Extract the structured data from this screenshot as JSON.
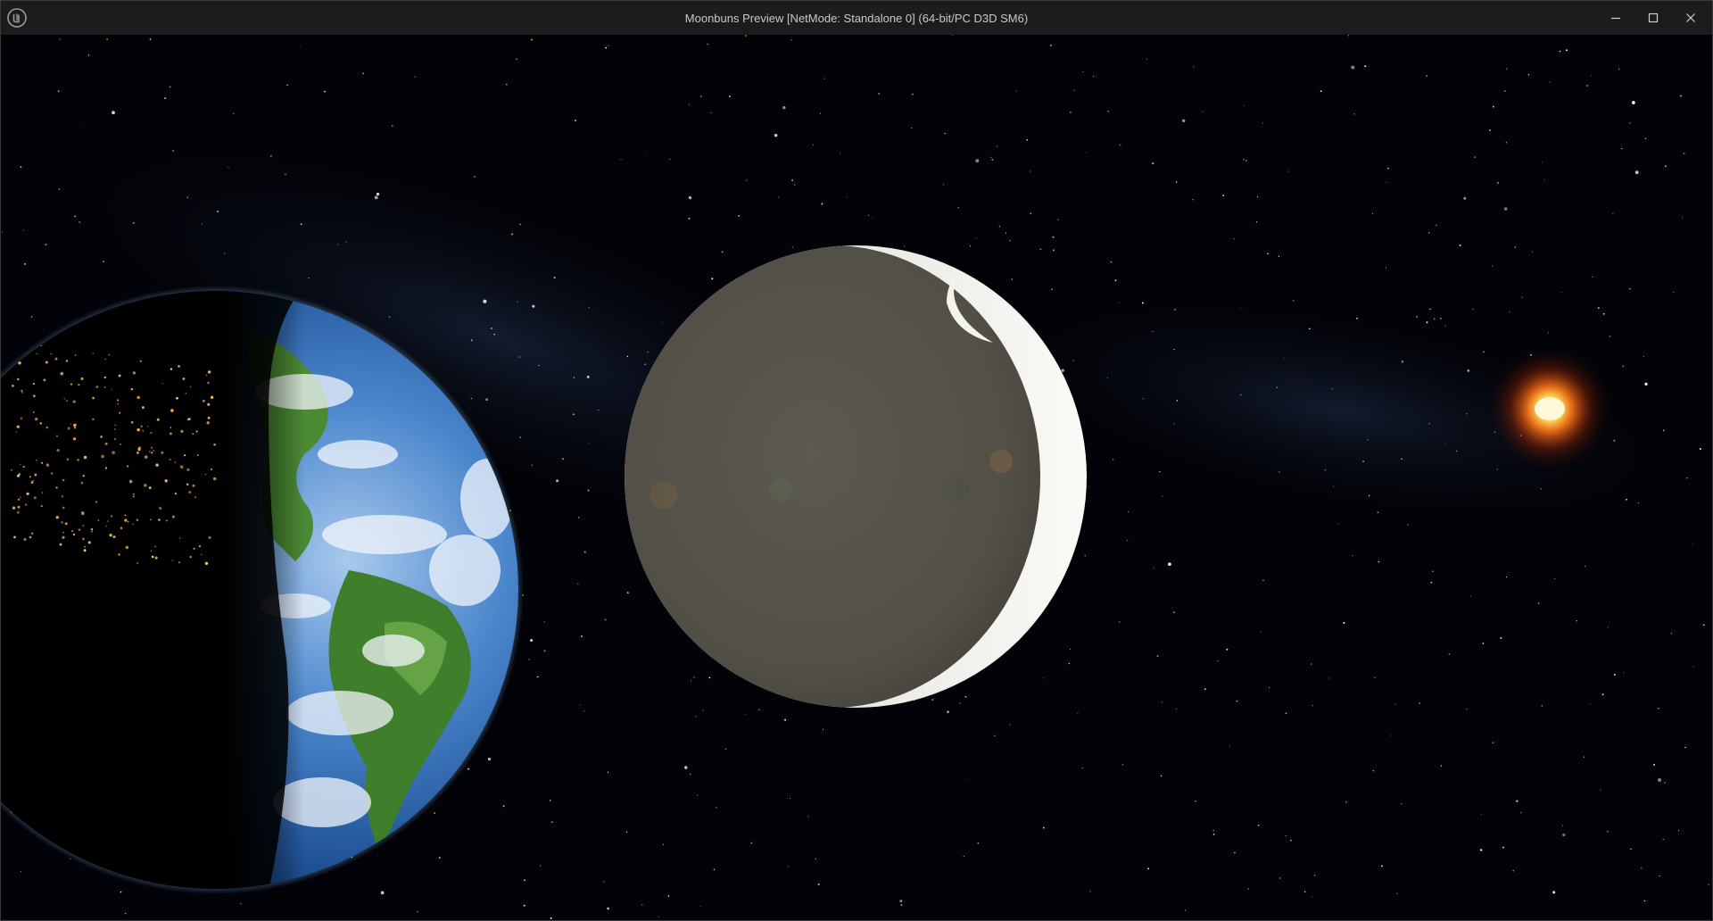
{
  "window": {
    "title": "Moonbuns Preview [NetMode: Standalone 0]  (64-bit/PC D3D SM6)",
    "app_icon": "unreal-engine-logo-icon",
    "controls": [
      {
        "name": "minimize-button",
        "icon": "minimize-icon"
      },
      {
        "name": "maximize-button",
        "icon": "maximize-icon"
      },
      {
        "name": "close-button",
        "icon": "close-icon"
      }
    ]
  },
  "scene": {
    "objects": [
      "starfield",
      "earth",
      "moon",
      "sun"
    ],
    "colors": {
      "space": "#020308",
      "moon_surface": "#5a574f",
      "moon_lit_rim": "#e8e6e0",
      "ocean": "#3f7fc8",
      "land": "#4d8a2e",
      "sun_core": "#fff6c8",
      "sun_glow": "#ff5a10"
    }
  }
}
